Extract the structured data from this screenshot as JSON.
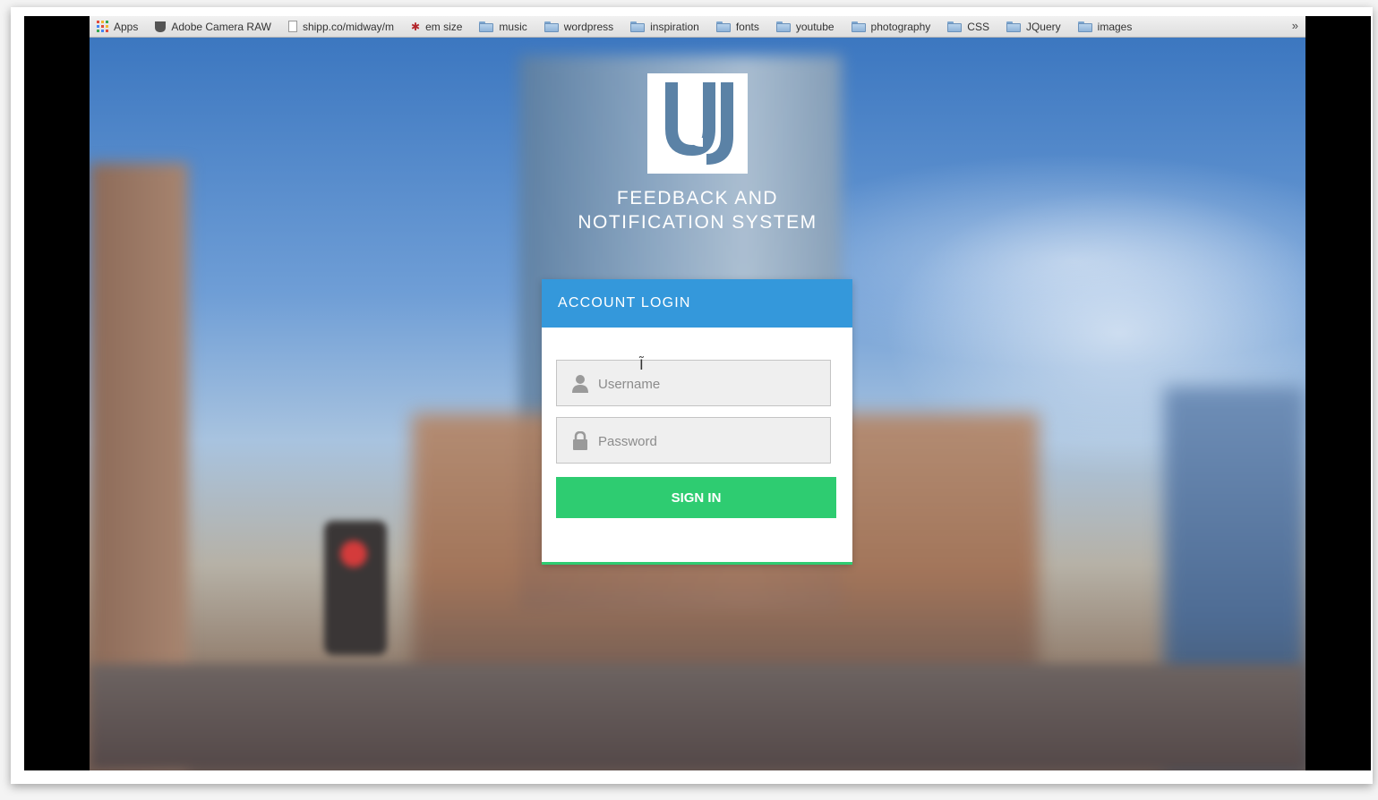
{
  "bookmarks": [
    {
      "label": "Apps",
      "icon": "apps-grid-icon"
    },
    {
      "label": "Adobe Camera RAW",
      "icon": "camera-icon"
    },
    {
      "label": "shipp.co/midway/m",
      "icon": "page-icon"
    },
    {
      "label": "em size",
      "icon": "star-icon"
    },
    {
      "label": "music",
      "icon": "folder-icon"
    },
    {
      "label": "wordpress",
      "icon": "folder-icon"
    },
    {
      "label": "inspiration",
      "icon": "folder-icon"
    },
    {
      "label": "fonts",
      "icon": "folder-icon"
    },
    {
      "label": "youtube",
      "icon": "folder-icon"
    },
    {
      "label": "photography",
      "icon": "folder-icon"
    },
    {
      "label": "CSS",
      "icon": "folder-icon"
    },
    {
      "label": "JQuery",
      "icon": "folder-icon"
    },
    {
      "label": "images",
      "icon": "folder-icon"
    }
  ],
  "bookmarks_more": "»",
  "app": {
    "title_line1": "FEEDBACK AND",
    "title_line2": "NOTIFICATION SYSTEM"
  },
  "login": {
    "header": "ACCOUNT LOGIN",
    "username_placeholder": "Username",
    "password_placeholder": "Password",
    "submit_label": "SIGN IN"
  },
  "colors": {
    "header_blue": "#3498db",
    "button_green": "#2ecc71"
  }
}
